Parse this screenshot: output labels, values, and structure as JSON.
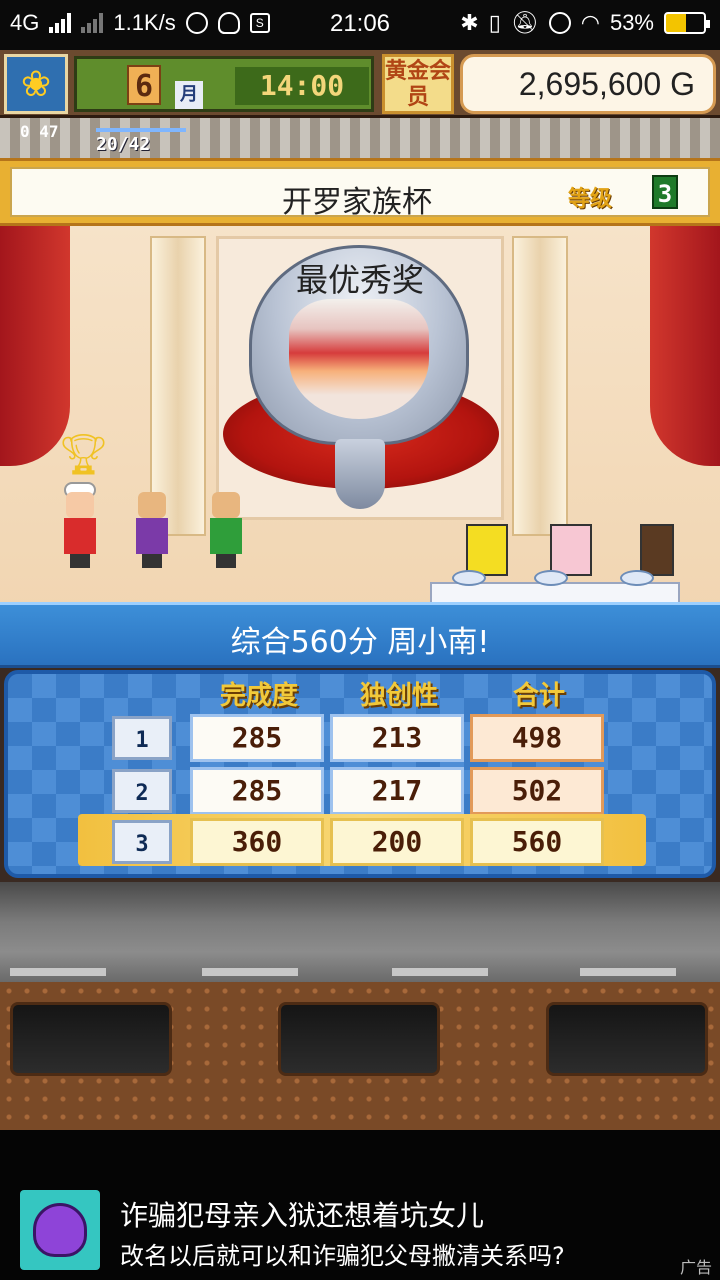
{
  "status_bar": {
    "network": "4G",
    "speed": "1.1K/s",
    "time": "21:06",
    "battery": "53%"
  },
  "hud": {
    "month_number": "6",
    "month_unit": "月",
    "clock": "14:00",
    "gold_member": "黄金会员",
    "money": "2,695,600 G",
    "stat_a": "0 47",
    "stat_b": "20/42"
  },
  "contest": {
    "name": "开罗家族杯",
    "level_label": "等级",
    "level_value": "3",
    "award": "最优秀奖"
  },
  "result": {
    "summary": "综合560分 周小南!",
    "columns": [
      "完成度",
      "独创性",
      "合计"
    ],
    "rows": [
      {
        "rank": "1",
        "completion": "285",
        "creativity": "213",
        "total": "498"
      },
      {
        "rank": "2",
        "completion": "285",
        "creativity": "217",
        "total": "502"
      },
      {
        "rank": "3",
        "completion": "360",
        "creativity": "200",
        "total": "560"
      }
    ]
  },
  "ad": {
    "title": "诈骗犯母亲入狱还想着坑女儿",
    "subtitle": "改名以后就可以和诈骗犯父母撇清关系吗?",
    "tag": "广告"
  },
  "colors": {
    "banner_blue": "#2a72c0",
    "gold": "#f2c03f",
    "curtain_red": "#a3161c"
  }
}
